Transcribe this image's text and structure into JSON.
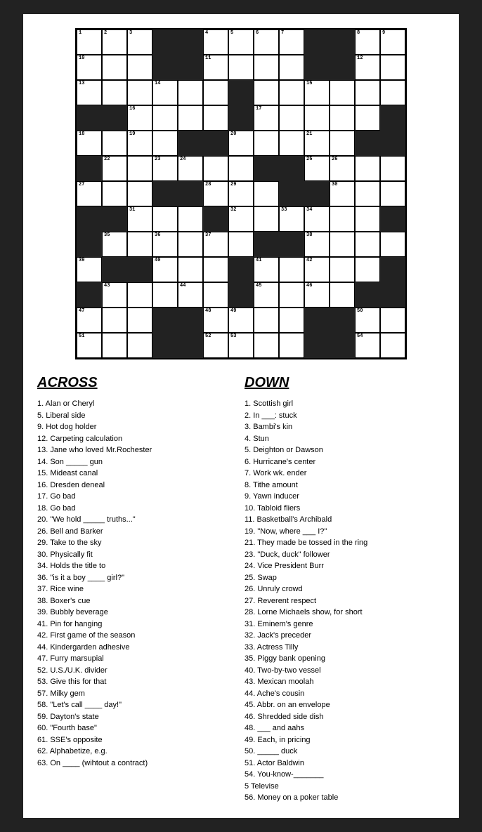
{
  "grid": {
    "rows": 13,
    "cols": 13,
    "black_cells": [
      [
        0,
        3
      ],
      [
        0,
        4
      ],
      [
        0,
        9
      ],
      [
        0,
        10
      ],
      [
        1,
        3
      ],
      [
        1,
        4
      ],
      [
        1,
        9
      ],
      [
        1,
        10
      ],
      [
        2,
        6
      ],
      [
        3,
        0
      ],
      [
        3,
        1
      ],
      [
        3,
        6
      ],
      [
        3,
        12
      ],
      [
        4,
        4
      ],
      [
        4,
        5
      ],
      [
        4,
        11
      ],
      [
        4,
        12
      ],
      [
        5,
        0
      ],
      [
        5,
        7
      ],
      [
        5,
        8
      ],
      [
        6,
        3
      ],
      [
        6,
        4
      ],
      [
        6,
        8
      ],
      [
        6,
        9
      ],
      [
        7,
        0
      ],
      [
        7,
        1
      ],
      [
        7,
        5
      ],
      [
        7,
        12
      ],
      [
        8,
        0
      ],
      [
        8,
        7
      ],
      [
        8,
        8
      ],
      [
        9,
        1
      ],
      [
        9,
        2
      ],
      [
        9,
        6
      ],
      [
        9,
        12
      ],
      [
        10,
        0
      ],
      [
        10,
        6
      ],
      [
        10,
        11
      ],
      [
        10,
        12
      ],
      [
        11,
        3
      ],
      [
        11,
        4
      ],
      [
        11,
        9
      ],
      [
        11,
        10
      ],
      [
        12,
        3
      ],
      [
        12,
        4
      ],
      [
        12,
        9
      ],
      [
        12,
        10
      ]
    ],
    "numbers": {
      "0,0": 1,
      "0,1": 2,
      "0,2": 3,
      "0,5": 4,
      "0,6": 5,
      "0,7": 6,
      "0,8": 7,
      "0,11": 8,
      "0,12": 9,
      "1,0": 10,
      "1,5": 11,
      "1,11": 12,
      "2,0": 13,
      "2,3": 14,
      "2,9": 15,
      "3,2": 16,
      "3,7": 17,
      "4,0": 18,
      "4,2": 19,
      "4,6": 20,
      "4,9": 21,
      "5,1": 22,
      "5,3": 23,
      "5,4": 24,
      "5,9": 25,
      "5,10": 26,
      "6,0": 27,
      "6,5": 28,
      "6,6": 29,
      "6,10": 30,
      "7,2": 31,
      "7,6": 32,
      "7,8": 33,
      "7,9": 34,
      "8,1": 35,
      "8,3": 36,
      "8,5": 37,
      "8,9": 38,
      "9,0": 39,
      "9,3": 40,
      "9,7": 41,
      "9,9": 42,
      "10,1": 43,
      "10,4": 44,
      "10,7": 45,
      "10,9": 46,
      "11,0": 47,
      "11,5": 48,
      "11,6": 49,
      "11,11": 50,
      "12,0": 51,
      "12,5": 52,
      "12,6": 53,
      "12,11": 54
    }
  },
  "across": {
    "title": "ACROSS",
    "clues": [
      "1. Alan or Cheryl",
      "5. Liberal side",
      "9. Hot dog holder",
      "12. Carpeting calculation",
      "13. Jane who loved Mr.Rochester",
      "14. Son _____ gun",
      "15. Mideast canal",
      "16. Dresden deneal",
      "17. Go bad",
      "18. Go bad",
      "20. \"We hold _____ truths...\"",
      "26. Bell and Barker",
      "29. Take to the sky",
      "30. Physically fit",
      "34. Holds the title to",
      "36. \"is it a boy ____ girl?\"",
      "37. Rice wine",
      "38. Boxer's cue",
      "39. Bubbly beverage",
      "41. Pin for hanging",
      "42. First game of the season",
      "44. Kindergarden adhesive",
      "47. Furry marsupial",
      "52. U.S./U.K. divider",
      "53. Give this for that",
      "57. Milky gem",
      "58. \"Let's call ____ day!\"",
      "59. Dayton's state",
      "60. \"Fourth base\"",
      "61. SSE's opposite",
      "62. Alphabetize, e.g.",
      "63. On ____ (wihtout a contract)"
    ]
  },
  "down": {
    "title": "DOWN",
    "clues": [
      "1. Scottish girl",
      "2. In ___: stuck",
      "3. Bambi's kin",
      "4. Stun",
      "5. Deighton or Dawson",
      "6. Hurricane's center",
      "7. Work wk. ender",
      "8. Tithe amount",
      "9. Yawn inducer",
      "10. Tabloid fliers",
      "11. Basketball's Archibald",
      "19. \"Now, where ___ I?\"",
      "21. They made be tossed in the ring",
      "23. \"Duck, duck\" follower",
      "24. Vice President Burr",
      "25. Swap",
      "26. Unruly crowd",
      "27. Reverent respect",
      "28. Lorne Michaels show, for short",
      "31. Eminem's genre",
      "32. Jack's preceder",
      "33. Actress Tilly",
      "35. Piggy bank opening",
      "40. Two-by-two vessel",
      "43. Mexican moolah",
      "44. Ache's cousin",
      "45. Abbr. on an envelope",
      "46. Shredded side dish",
      "48. ___ and aahs",
      "49. Each, in pricing",
      "50. _____ duck",
      "51. Actor Baldwin",
      "54. You-know-_______",
      "5 Televise",
      "56. Money on a poker table"
    ]
  }
}
